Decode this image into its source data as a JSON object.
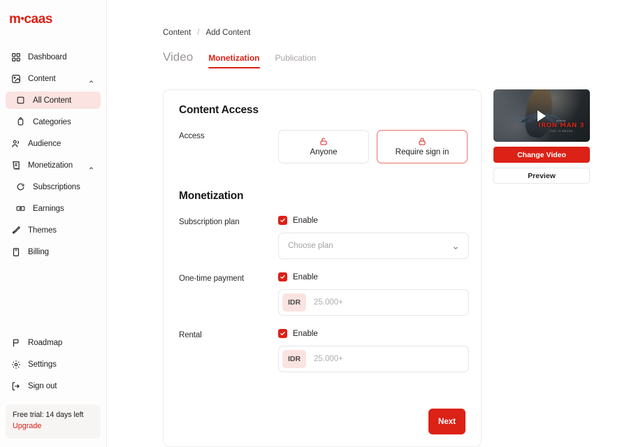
{
  "app": {
    "logo_main": "m",
    "logo_dot": "•",
    "logo_tail": "caas",
    "accent_color": "#dc2116",
    "accent_soft": "#fae3e0"
  },
  "sidebar": {
    "items": [
      {
        "label": "Dashboard",
        "icon": "grid-icon",
        "level": 0,
        "active": false,
        "chevron": ""
      },
      {
        "label": "Content",
        "icon": "image-icon",
        "level": 0,
        "active": false,
        "chevron": "up"
      },
      {
        "label": "All Content",
        "icon": "square-icon",
        "level": 1,
        "active": true,
        "chevron": ""
      },
      {
        "label": "Categories",
        "icon": "tag-icon",
        "level": 1,
        "active": false,
        "chevron": ""
      },
      {
        "label": "Audience",
        "icon": "users-icon",
        "level": 0,
        "active": false,
        "chevron": ""
      },
      {
        "label": "Monetization",
        "icon": "receipt-icon",
        "level": 0,
        "active": false,
        "chevron": "up"
      },
      {
        "label": "Subscriptions",
        "icon": "refresh-icon",
        "level": 1,
        "active": false,
        "chevron": ""
      },
      {
        "label": "Earnings",
        "icon": "banknote-icon",
        "level": 1,
        "active": false,
        "chevron": ""
      },
      {
        "label": "Themes",
        "icon": "brush-icon",
        "level": 0,
        "active": false,
        "chevron": ""
      },
      {
        "label": "Billing",
        "icon": "creditcard-icon",
        "level": 0,
        "active": false,
        "chevron": ""
      }
    ],
    "bottom_items": [
      {
        "label": "Roadmap",
        "icon": "flag-icon"
      },
      {
        "label": "Settings",
        "icon": "gear-icon"
      },
      {
        "label": "Sign out",
        "icon": "signout-icon"
      }
    ],
    "trial": {
      "text": "Free trial: 14 days left",
      "link": "Upgrade"
    }
  },
  "breadcrumb": {
    "parent": "Content",
    "separator": "/",
    "current": "Add Content"
  },
  "tabs": [
    {
      "label": "Video",
      "active": false,
      "big": true
    },
    {
      "label": "Monetization",
      "active": true,
      "big": false
    },
    {
      "label": "Publication",
      "active": false,
      "big": false
    }
  ],
  "content_access": {
    "title": "Content Access",
    "row_label": "Access",
    "options": [
      {
        "label": "Anyone",
        "icon": "unlock-icon",
        "selected": false
      },
      {
        "label": "Require sign in",
        "icon": "lock-icon",
        "selected": true
      }
    ]
  },
  "monetization": {
    "title": "Monetization",
    "subscription": {
      "row_label": "Subscription plan",
      "checkbox_label": "Enable",
      "checked": true,
      "select_value": "",
      "select_placeholder": "Choose plan",
      "chevron": "chevron-down-icon"
    },
    "one_time": {
      "row_label": "One-time payment",
      "checkbox_label": "Enable",
      "checked": true,
      "currency": "IDR",
      "amount_value": "",
      "amount_placeholder": "25.000+"
    },
    "rental": {
      "row_label": "Rental",
      "checkbox_label": "Enable",
      "checked": true,
      "currency": "IDR",
      "amount_value": "",
      "amount_placeholder": "25.000+"
    }
  },
  "footer": {
    "next_label": "Next"
  },
  "preview_rail": {
    "thumbnail": {
      "play_icon": "play-icon",
      "studio_text": "MARVEL",
      "title_text": "IRON MAN 3",
      "tagline_text": "THAT IS WRONG"
    },
    "change_video_label": "Change Video",
    "preview_label": "Preview"
  }
}
